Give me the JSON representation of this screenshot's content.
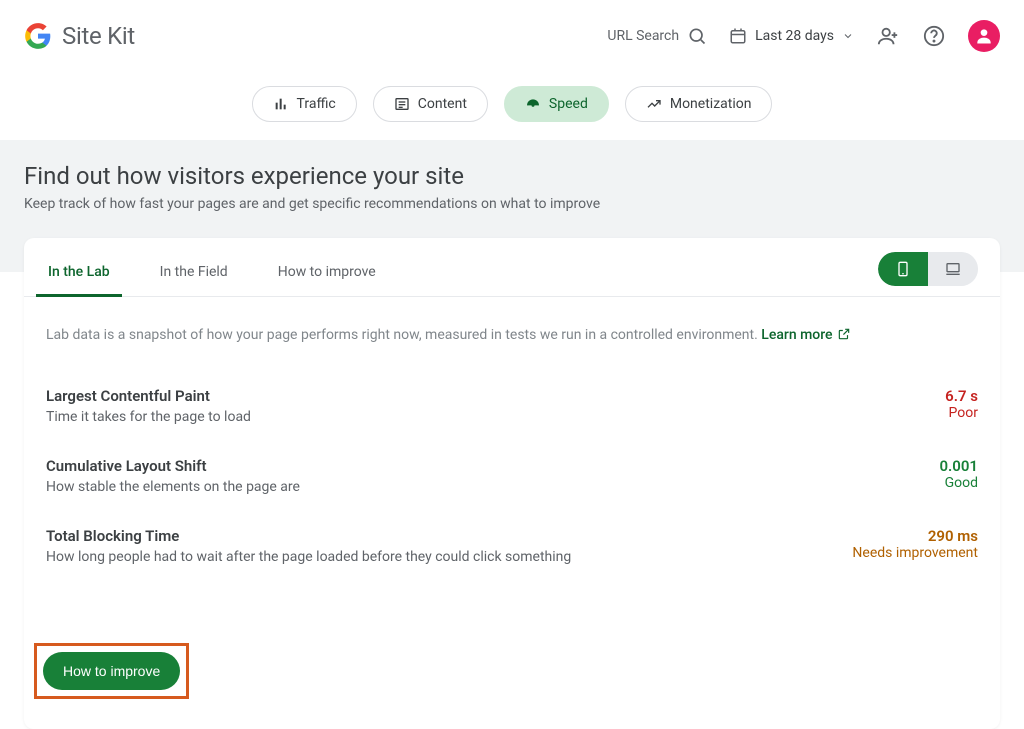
{
  "header": {
    "brand": "Site Kit",
    "url_search": "URL Search",
    "date_range": "Last 28 days"
  },
  "nav": {
    "traffic": "Traffic",
    "content": "Content",
    "speed": "Speed",
    "monetization": "Monetization"
  },
  "hero": {
    "title": "Find out how visitors experience your site",
    "subtitle": "Keep track of how fast your pages are and get specific recommendations on what to improve"
  },
  "tabs": {
    "lab": "In the Lab",
    "field": "In the Field",
    "improve": "How to improve"
  },
  "lab_desc_prefix": "Lab data is a snapshot of how your page performs right now, measured in tests we run in a controlled environment. ",
  "learn_more": "Learn more",
  "metrics": {
    "lcp": {
      "title": "Largest Contentful Paint",
      "sub": "Time it takes for the page to load",
      "value": "6.7 s",
      "rating": "Poor"
    },
    "cls": {
      "title": "Cumulative Layout Shift",
      "sub": "How stable the elements on the page are",
      "value": "0.001",
      "rating": "Good"
    },
    "tbt": {
      "title": "Total Blocking Time",
      "sub": "How long people had to wait after the page loaded before they could click something",
      "value": "290 ms",
      "rating": "Needs improvement"
    }
  },
  "improve_button": "How to improve"
}
